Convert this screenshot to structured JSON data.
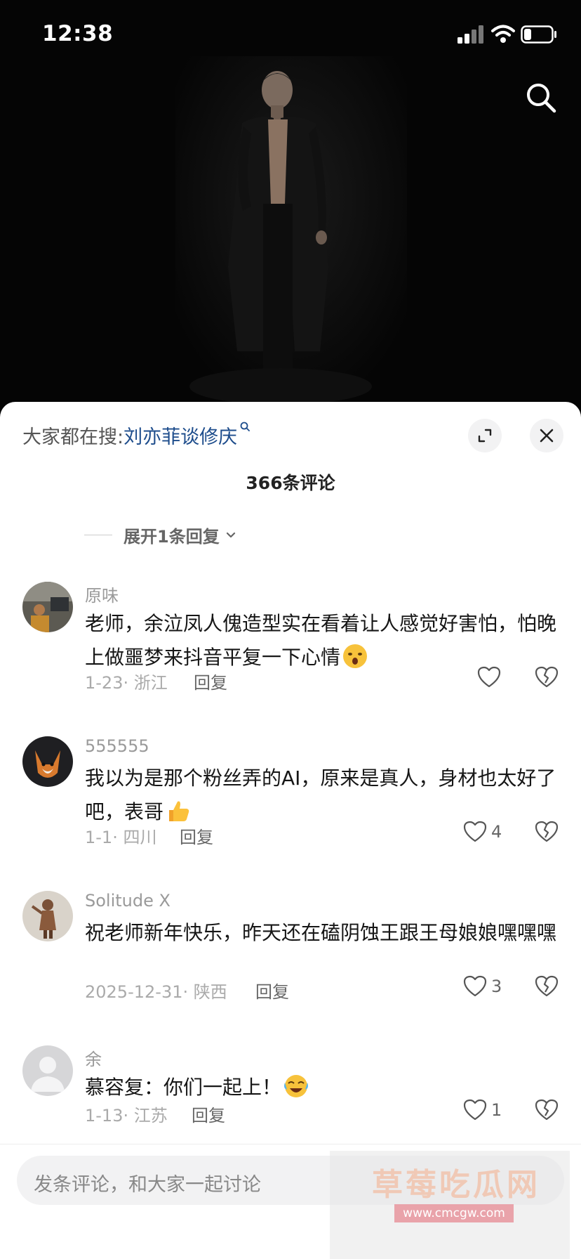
{
  "status_bar": {
    "time": "12:38"
  },
  "sheet": {
    "trending_prefix": "大家都在搜:",
    "trending_term": "刘亦菲谈修庆",
    "comment_count": "366条评论",
    "expand_replies": "展开1条回复"
  },
  "comments": [
    {
      "username": "原味",
      "text": "老师，余泣凤人傀造型实在看着让人感觉好害怕，怕晚上做噩梦来抖音平复一下心情",
      "emoji": "shocked-face",
      "date_location": "1-23· 浙江",
      "reply_label": "回复",
      "likes": ""
    },
    {
      "username": "555555",
      "text": "我以为是那个粉丝弄的AI，原来是真人，身材也太好了吧，表哥",
      "emoji": "thumbs-up",
      "date_location": "1-1· 四川",
      "reply_label": "回复",
      "likes": "4"
    },
    {
      "username": "Solitude X",
      "text": "祝老师新年快乐，昨天还在磕阴蚀王跟王母娘娘嘿嘿嘿",
      "emoji": "",
      "date_location": "2025-12-31· 陕西",
      "reply_label": "回复",
      "likes": "3"
    },
    {
      "username": "余",
      "text": "慕容复：你们一起上！",
      "emoji": "crying-laughing",
      "date_location": "1-13· 江苏",
      "reply_label": "回复",
      "likes": "1"
    }
  ],
  "input": {
    "placeholder": "发条评论，和大家一起讨论"
  },
  "watermark": {
    "title": "草莓吃瓜网",
    "url": "www.cmcgw.com"
  },
  "colors": {
    "link": "#1e4d8c",
    "sheet_bg": "#ffffff",
    "muted": "#9a9a9a"
  }
}
